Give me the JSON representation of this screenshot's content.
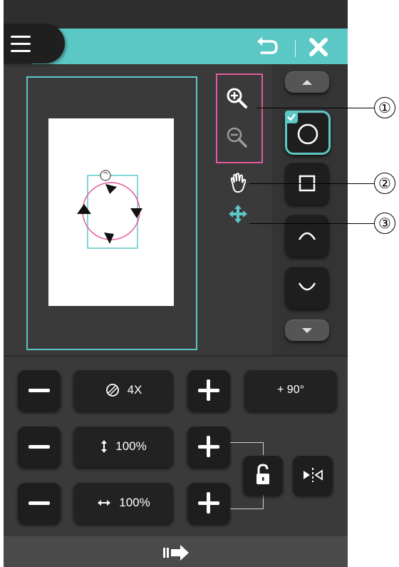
{
  "header": {
    "menu_icon": "menu-icon",
    "undo_icon": "undo-icon",
    "close_icon": "close-icon",
    "accent_color": "#5cc8c5"
  },
  "tools": {
    "zoom_in_icon": "zoom-in-icon",
    "zoom_out_icon": "zoom-out-icon",
    "pan_icon": "hand-icon",
    "move_icon": "move-arrows-icon",
    "highlight_color": "#e35a9f"
  },
  "shapes": {
    "items": [
      {
        "name": "circle",
        "selected": true
      },
      {
        "name": "square",
        "selected": false
      },
      {
        "name": "arc-top",
        "selected": false
      },
      {
        "name": "arc-bottom",
        "selected": false
      }
    ]
  },
  "controls": {
    "density_value": "4X",
    "rotate_label": "+ 90°",
    "height_value": "100%",
    "width_value": "100%"
  },
  "callouts": [
    "①",
    "②",
    "③"
  ]
}
